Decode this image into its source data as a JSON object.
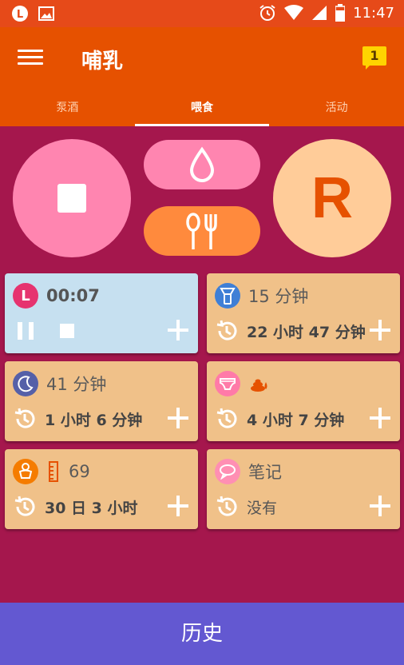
{
  "status_bar": {
    "time": "11:47",
    "left_icons": [
      "l-badge-icon",
      "image-icon"
    ],
    "right_icons": [
      "alarm-icon",
      "wifi-icon",
      "signal-icon",
      "battery-icon"
    ]
  },
  "app_bar": {
    "title": "哺乳",
    "notification_count": "1",
    "tabs": [
      {
        "label": "泵酒",
        "active": false
      },
      {
        "label": "喂食",
        "active": true
      },
      {
        "label": "活动",
        "active": false
      }
    ]
  },
  "controls": {
    "stop_icon": "stop-icon",
    "bottle_icon": "drop-icon",
    "solid_icon": "spoon-fork-icon",
    "right_side_label": "R"
  },
  "cards": [
    {
      "id": "breast",
      "badge": "L",
      "title": "00:07",
      "icon": "l-badge-icon"
    },
    {
      "id": "pump",
      "title": "15 分钟",
      "since": "22 小时 47 分钟",
      "icon": "pump-icon"
    },
    {
      "id": "sleep",
      "title": "41 分钟",
      "since": "1 小时 6 分钟",
      "icon": "moon-icon"
    },
    {
      "id": "diaper",
      "since": "4 小时 7 分钟",
      "icon": "diaper-icon",
      "extra_icon": "poop-icon"
    },
    {
      "id": "growth",
      "title": "69",
      "since": "30 日 3 小时",
      "icon": "baby-icon",
      "extra_icon": "ruler-icon"
    },
    {
      "id": "notes",
      "title": "笔记",
      "since": "没有",
      "icon": "speech-icon"
    }
  ],
  "colors": {
    "background": "#a5174d",
    "appbar": "#e65100",
    "card": "#f0c189",
    "active_card": "#c6e0f0",
    "history_button": "#6358d1"
  },
  "history_button": {
    "label": "历史"
  }
}
